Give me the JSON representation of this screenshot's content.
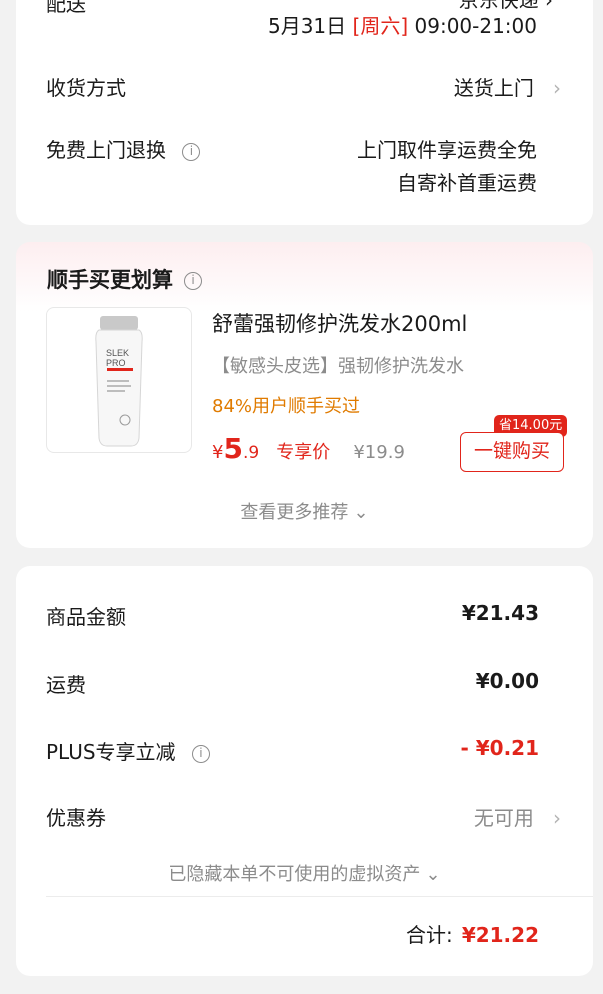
{
  "delivery": {
    "date": "5月31日",
    "weekday": "[周六]",
    "time": "09:00-21:00",
    "receive_method_label": "收货方式",
    "receive_method_value": "送货上门",
    "free_return_label": "免费上门退换",
    "free_return_line1": "上门取件享运费全免",
    "free_return_line2": "自寄补首重运费"
  },
  "recommendation": {
    "title": "顺手买更划算",
    "product": {
      "name": "舒蕾强韧修护洗发水200ml",
      "subtitle": "【敏感头皮选】强韧修护洗发水",
      "stat": "84%用户顺手买过",
      "price_symbol": "¥",
      "price_int": "5",
      "price_dec": ".9",
      "price_tag": "专享价",
      "original_price": "¥19.9",
      "save_badge": "省14.00元",
      "buy_label": "一键购买",
      "image_brand_line1": "SLEK",
      "image_brand_line2": "PRO"
    },
    "more_label": "查看更多推荐"
  },
  "summary": {
    "rows": [
      {
        "label": "商品金额",
        "value": "¥21.43"
      },
      {
        "label": "运费",
        "value": "¥0.00"
      },
      {
        "label": "PLUS专享立减",
        "value": "- ¥0.21"
      },
      {
        "label": "优惠券",
        "value": "无可用"
      }
    ],
    "hidden_assets_label": "已隐藏本单不可使用的虚拟资产",
    "total_label": "合计:",
    "total_value": "¥21.22"
  },
  "colors": {
    "accent_red": "#e1251b",
    "orange": "#e07b00",
    "muted": "#8c8c8c"
  }
}
